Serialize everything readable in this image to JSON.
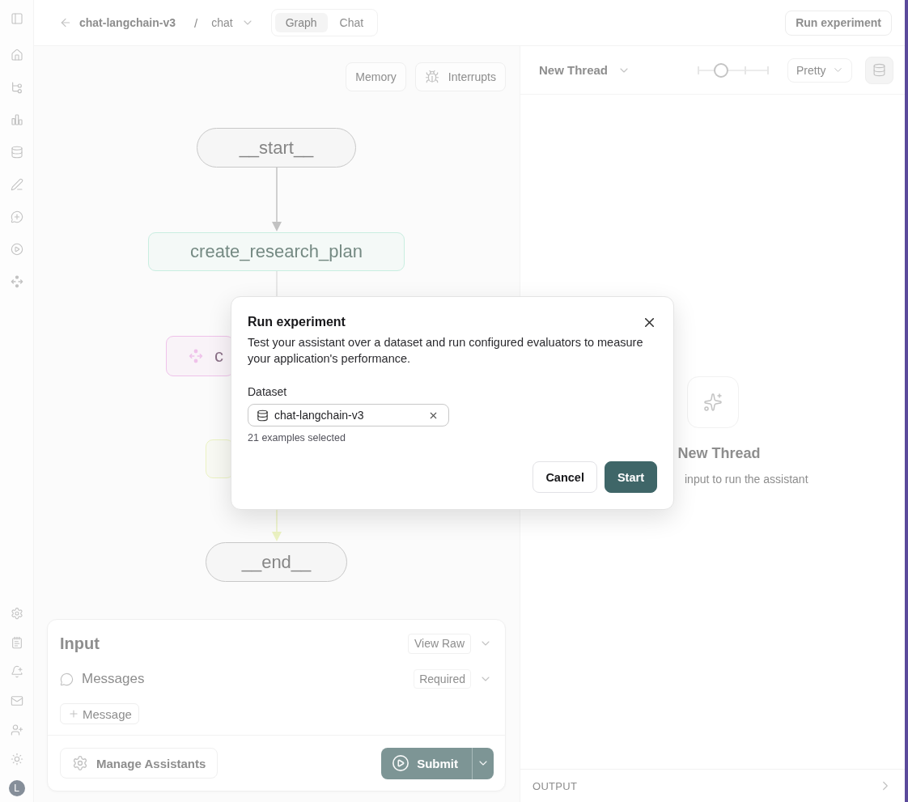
{
  "sidebar": {
    "avatar_initial": "L"
  },
  "header": {
    "project": "chat-langchain-v3",
    "separator": "/",
    "graph_select": "chat",
    "view_tabs": [
      {
        "label": "Graph",
        "selected": true
      },
      {
        "label": "Chat",
        "selected": false
      }
    ],
    "run_button": "Run experiment"
  },
  "graph": {
    "toolbar": [
      {
        "label": "Memory",
        "kind": "text"
      },
      {
        "label": "Interrupts",
        "kind": "debug"
      }
    ],
    "nodes": [
      {
        "kind": "terminal",
        "label": "__start__"
      },
      {
        "kind": "step",
        "label": "create_research_plan",
        "color": "#c9eee1"
      },
      {
        "kind": "subgraph",
        "label": "c",
        "color": "#efc2ea"
      },
      {
        "kind": "step",
        "color": "#ebf2c2"
      },
      {
        "kind": "terminal",
        "label": "__end__"
      }
    ]
  },
  "input": {
    "title": "Input",
    "view_button": "View Raw",
    "field": {
      "label": "Messages",
      "badge": "Required",
      "add_button": "Message"
    },
    "manage_button": "Manage Assistants",
    "submit_button": "Submit"
  },
  "thread": {
    "thread_select": "New Thread",
    "zoom_slider": {
      "level": 0.33
    },
    "format_select": "Pretty",
    "empty_state": {
      "title": "New Thread",
      "subtitle": "input to run the assistant"
    },
    "output_label": "OUTPUT"
  },
  "dialog": {
    "title": "Run experiment",
    "description": "Test your assistant over a dataset and run configured evaluators to measure your application's performance.",
    "dataset_label": "Dataset",
    "dataset_value": "chat-langchain-v3",
    "selection_note": "21 examples selected",
    "buttons": [
      {
        "label": "Cancel",
        "kind": "secondary"
      },
      {
        "label": "Start",
        "kind": "primary"
      }
    ]
  }
}
